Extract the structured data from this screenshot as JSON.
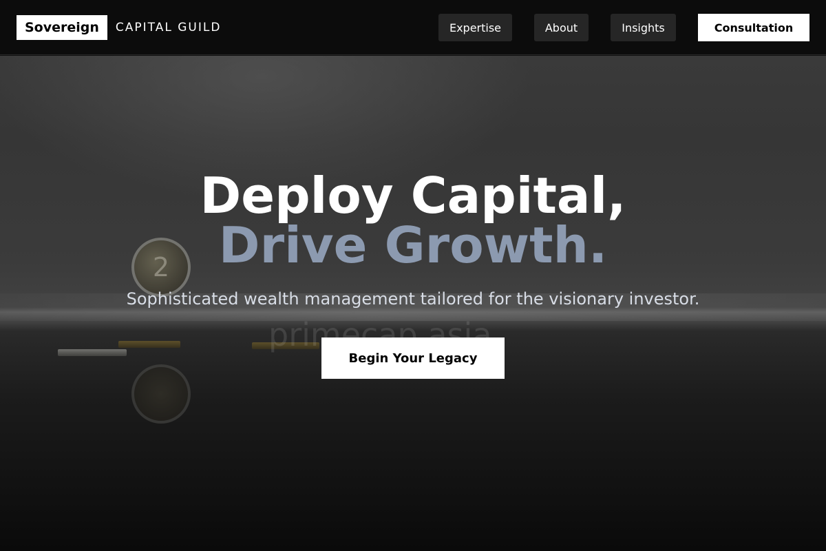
{
  "header": {
    "brand": {
      "logo_text": "Sovereign",
      "name": "CAPITAL GUILD"
    },
    "nav": [
      {
        "label": "Expertise"
      },
      {
        "label": "About"
      },
      {
        "label": "Insights"
      }
    ],
    "cta_label": "Consultation"
  },
  "hero": {
    "title_line1": "Deploy Capital,",
    "title_line2": "Drive Growth.",
    "subtitle": "Sophisticated wealth management tailored for the visionary investor.",
    "cta_label": "Begin Your Legacy",
    "background_watermark": "primecap.asia",
    "coin_glyph": "2"
  },
  "colors": {
    "accent": "#8c9ab0",
    "header_bg": "#0c0c0c",
    "nav_button_bg": "#262626",
    "primary_button_bg": "#ffffff"
  }
}
